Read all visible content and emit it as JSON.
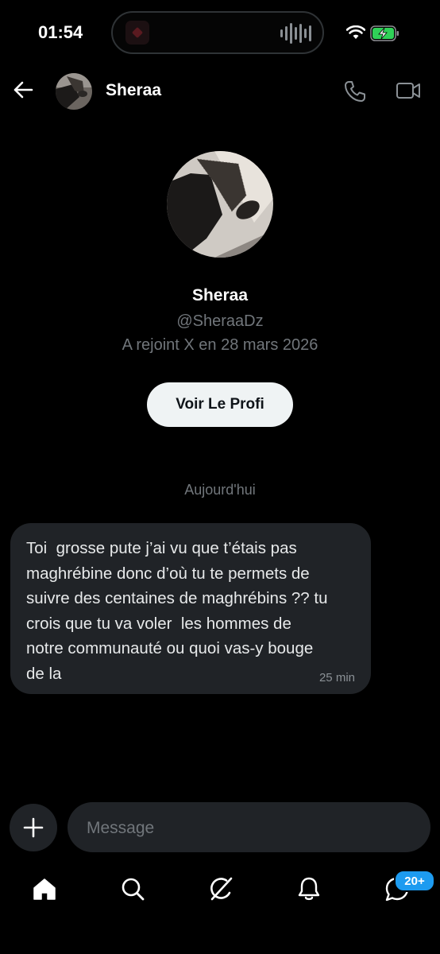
{
  "status_bar": {
    "time": "01:54",
    "battery_color": "#30d158"
  },
  "header": {
    "back_icon": "arrow-left-icon",
    "name": "Sheraa",
    "call_icon": "phone-icon",
    "video_icon": "video-camera-icon"
  },
  "profile": {
    "name": "Sheraa",
    "handle": "@SheraaDz",
    "joined": "A rejoint X en 28 mars 2026",
    "button_label": "Voir Le Profi"
  },
  "conversation": {
    "date_separator": "Aujourd'hui",
    "messages": [
      {
        "text": "Toi  grosse pute j’ai vu que t’étais pas\nmaghrébine donc d’où tu te permets de\nsuivre des centaines de maghrébins ?? tu\ncrois que tu va voler  les hommes de\nnotre communauté ou quoi vas-y bouge\nde la",
        "time": "25 min"
      }
    ]
  },
  "composer": {
    "add_icon": "plus-icon",
    "placeholder": "Message"
  },
  "tab_bar": {
    "items": [
      "home-icon",
      "search-icon",
      "grok-icon",
      "notifications-bell-icon",
      "messages-icon"
    ],
    "messages_badge": "20+",
    "badge_color": "#1d9bf0"
  }
}
